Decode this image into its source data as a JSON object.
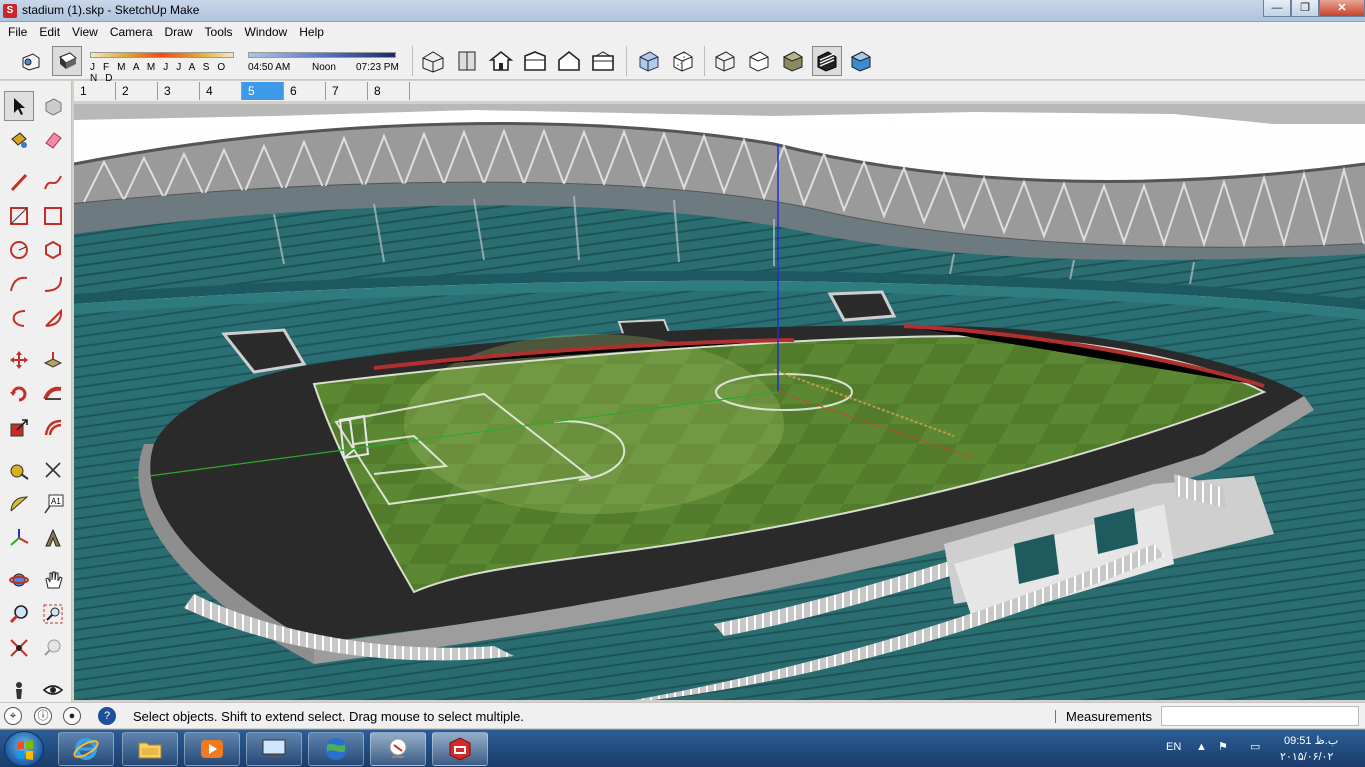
{
  "window": {
    "title": "stadium (1).skp - SketchUp Make",
    "minimize": "—",
    "maximize": "❐",
    "close": "✕"
  },
  "menu": [
    "File",
    "Edit",
    "View",
    "Camera",
    "Draw",
    "Tools",
    "Window",
    "Help"
  ],
  "shadows": {
    "months": "J F M A M J J A S O N D",
    "time_start": "04:50 AM",
    "time_mid": "Noon",
    "time_end": "07:23 PM"
  },
  "scenes": {
    "tabs": [
      "1",
      "2",
      "3",
      "4",
      "5",
      "6",
      "7",
      "8"
    ],
    "active_index": 4
  },
  "status": {
    "message": "Select objects. Shift to extend select. Drag mouse to select multiple.",
    "measurements_label": "Measurements",
    "measurements_value": ""
  },
  "taskbar": {
    "language": "EN",
    "time": "09:51 ب.ظ",
    "date": "۲۰۱۵/۰۶/۰۲"
  },
  "colors": {
    "accent_tab": "#3d9ae8",
    "pitch": "#4f7a2a",
    "seats": "#2a6e72",
    "red_axis": "#d43c2c",
    "green_axis": "#2fa82f",
    "blue_axis": "#2030d0"
  }
}
